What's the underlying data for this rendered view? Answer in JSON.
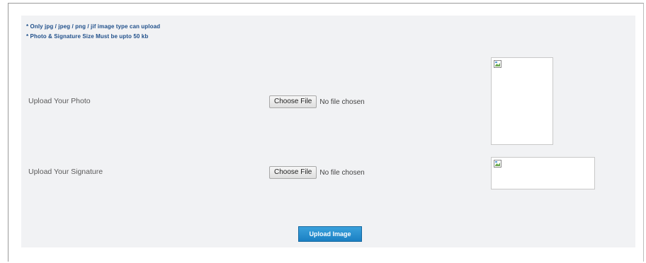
{
  "notes": [
    "* Only jpg / jpeg / png / jif image type can upload",
    "* Photo & Signature Size Must be upto 50 kb"
  ],
  "photo": {
    "label": "Upload Your Photo",
    "button_label": "Choose File",
    "status": "No file chosen"
  },
  "signature": {
    "label": "Upload Your Signature",
    "button_label": "Choose File",
    "status": "No file chosen"
  },
  "upload_button_label": "Upload Image",
  "colors": {
    "panel_background": "#f1f2f4",
    "note_text": "#1f4f8a",
    "upload_button": "#2a90d0"
  },
  "icons": {
    "photo_preview": "broken-image-icon",
    "signature_preview": "broken-image-icon"
  }
}
